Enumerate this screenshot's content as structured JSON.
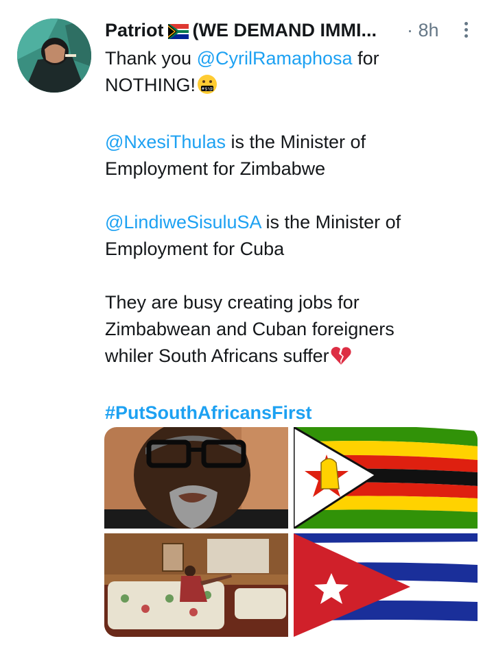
{
  "tweet": {
    "author_name": "Patriot",
    "author_suffix": "(WE DEMAND IMMI...",
    "flag_emoji": "south-africa-flag",
    "time_prefix": "·",
    "time": "8h",
    "lines": {
      "l1_pre": "Thank you ",
      "l1_mention": "@CyrilRamaphosa",
      "l1_post": " for",
      "l2": "NOTHING!",
      "l3_mention": "@NxesiThulas",
      "l3_post": " is the Minister of",
      "l4": "Employment for Zimbabwe",
      "l5_mention": "@LindiweSisuluSA",
      "l5_post": " is the Minister of",
      "l6": "Employment for Cuba",
      "l7": "They are busy creating jobs for",
      "l8": "Zimbabwean and Cuban foreigners",
      "l9": "whiler South Africans suffer",
      "hashtag": "#PutSouthAfricansFirst"
    },
    "emojis": [
      "cursing-face-emoji",
      "broken-heart-emoji"
    ],
    "media": [
      {
        "name": "photo-man-glasses"
      },
      {
        "name": "zimbabwe-flag-photo"
      },
      {
        "name": "photo-woman-sofa"
      },
      {
        "name": "cuba-flag-photo"
      }
    ]
  },
  "colors": {
    "link": "#1da1f2",
    "text": "#14171a",
    "muted": "#657786"
  }
}
